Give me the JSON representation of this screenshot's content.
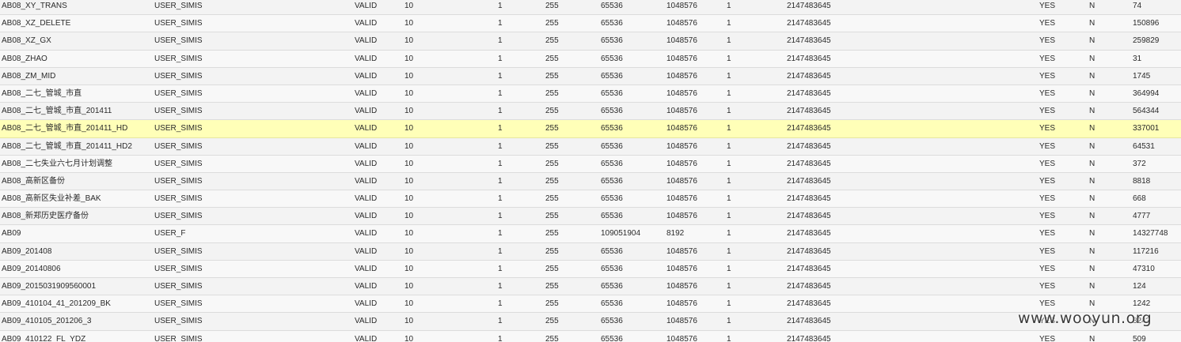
{
  "rows": [
    [
      "AB08_XY_TRANS",
      "USER_SIMIS",
      "VALID",
      "10",
      "1",
      "255",
      "65536",
      "1048576",
      "1",
      "2147483645",
      "YES",
      "N",
      "74"
    ],
    [
      "AB08_XZ_DELETE",
      "USER_SIMIS",
      "VALID",
      "10",
      "1",
      "255",
      "65536",
      "1048576",
      "1",
      "2147483645",
      "YES",
      "N",
      "150896"
    ],
    [
      "AB08_XZ_GX",
      "USER_SIMIS",
      "VALID",
      "10",
      "1",
      "255",
      "65536",
      "1048576",
      "1",
      "2147483645",
      "YES",
      "N",
      "259829"
    ],
    [
      "AB08_ZHAO",
      "USER_SIMIS",
      "VALID",
      "10",
      "1",
      "255",
      "65536",
      "1048576",
      "1",
      "2147483645",
      "YES",
      "N",
      "31"
    ],
    [
      "AB08_ZM_MID",
      "USER_SIMIS",
      "VALID",
      "10",
      "1",
      "255",
      "65536",
      "1048576",
      "1",
      "2147483645",
      "YES",
      "N",
      "1745"
    ],
    [
      "AB08_二七_管城_市直",
      "USER_SIMIS",
      "VALID",
      "10",
      "1",
      "255",
      "65536",
      "1048576",
      "1",
      "2147483645",
      "YES",
      "N",
      "364994"
    ],
    [
      "AB08_二七_管城_市直_201411",
      "USER_SIMIS",
      "VALID",
      "10",
      "1",
      "255",
      "65536",
      "1048576",
      "1",
      "2147483645",
      "YES",
      "N",
      "564344"
    ],
    [
      "AB08_二七_管城_市直_201411_HD",
      "USER_SIMIS",
      "VALID",
      "10",
      "1",
      "255",
      "65536",
      "1048576",
      "1",
      "2147483645",
      "YES",
      "N",
      "337001"
    ],
    [
      "AB08_二七_管城_市直_201411_HD2",
      "USER_SIMIS",
      "VALID",
      "10",
      "1",
      "255",
      "65536",
      "1048576",
      "1",
      "2147483645",
      "YES",
      "N",
      "64531"
    ],
    [
      "AB08_二七失业六七月计划调整",
      "USER_SIMIS",
      "VALID",
      "10",
      "1",
      "255",
      "65536",
      "1048576",
      "1",
      "2147483645",
      "YES",
      "N",
      "372"
    ],
    [
      "AB08_高新区备份",
      "USER_SIMIS",
      "VALID",
      "10",
      "1",
      "255",
      "65536",
      "1048576",
      "1",
      "2147483645",
      "YES",
      "N",
      "8818"
    ],
    [
      "AB08_高新区失业补差_BAK",
      "USER_SIMIS",
      "VALID",
      "10",
      "1",
      "255",
      "65536",
      "1048576",
      "1",
      "2147483645",
      "YES",
      "N",
      "668"
    ],
    [
      "AB08_新郑历史医疗备份",
      "USER_SIMIS",
      "VALID",
      "10",
      "1",
      "255",
      "65536",
      "1048576",
      "1",
      "2147483645",
      "YES",
      "N",
      "4777"
    ],
    [
      "AB09",
      "USER_F",
      "VALID",
      "10",
      "1",
      "255",
      "109051904",
      "8192",
      "1",
      "2147483645",
      "YES",
      "N",
      "14327748"
    ],
    [
      "AB09_201408",
      "USER_SIMIS",
      "VALID",
      "10",
      "1",
      "255",
      "65536",
      "1048576",
      "1",
      "2147483645",
      "YES",
      "N",
      "117216"
    ],
    [
      "AB09_20140806",
      "USER_SIMIS",
      "VALID",
      "10",
      "1",
      "255",
      "65536",
      "1048576",
      "1",
      "2147483645",
      "YES",
      "N",
      "47310"
    ],
    [
      "AB09_2015031909560001",
      "USER_SIMIS",
      "VALID",
      "10",
      "1",
      "255",
      "65536",
      "1048576",
      "1",
      "2147483645",
      "YES",
      "N",
      "124"
    ],
    [
      "AB09_410104_41_201209_BK",
      "USER_SIMIS",
      "VALID",
      "10",
      "1",
      "255",
      "65536",
      "1048576",
      "1",
      "2147483645",
      "YES",
      "N",
      "1242"
    ],
    [
      "AB09_410105_201206_3",
      "USER_SIMIS",
      "VALID",
      "10",
      "1",
      "255",
      "65536",
      "1048576",
      "1",
      "2147483645",
      "YES",
      "N",
      "8243"
    ],
    [
      "AB09_410122_FL_YDZ",
      "USER_SIMIS",
      "VALID",
      "10",
      "1",
      "255",
      "65536",
      "1048576",
      "1",
      "2147483645",
      "YES",
      "N",
      "509"
    ]
  ],
  "highlighted_row": 7,
  "watermark": "www.wooyun.org"
}
